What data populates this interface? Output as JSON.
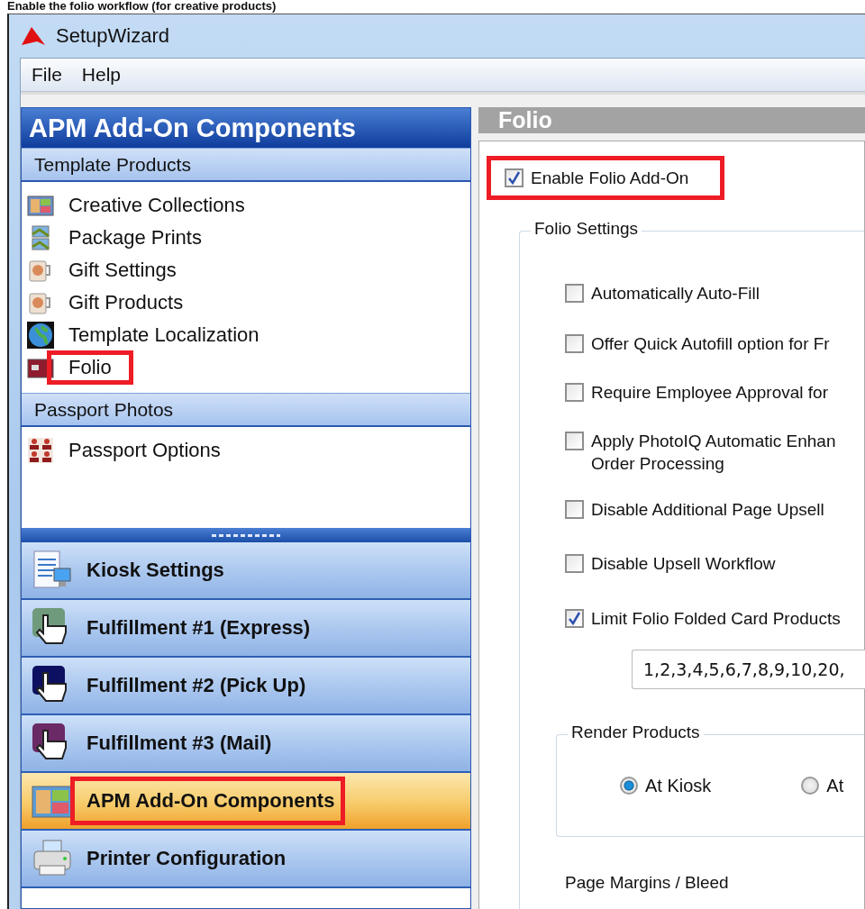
{
  "caption": "Enable the folio workflow (for creative products)",
  "window": {
    "title": "SetupWizard"
  },
  "menu": [
    "File",
    "Help"
  ],
  "sidebar": {
    "title": "APM Add-On Components",
    "sections": [
      {
        "title": "Template Products",
        "items": [
          {
            "label": "Creative Collections",
            "kind": "collage",
            "highlighted": false
          },
          {
            "label": "Package Prints",
            "kind": "prints",
            "highlighted": false
          },
          {
            "label": "Gift Settings",
            "kind": "mug",
            "highlighted": false
          },
          {
            "label": "Gift Products",
            "kind": "mug",
            "highlighted": false
          },
          {
            "label": "Template Localization",
            "kind": "globe",
            "highlighted": false
          },
          {
            "label": "Folio",
            "kind": "folio",
            "highlighted": true
          }
        ]
      },
      {
        "title": "Passport Photos",
        "items": [
          {
            "label": "Passport Options",
            "kind": "passport",
            "highlighted": false
          }
        ]
      }
    ],
    "nav": [
      {
        "label": "Kiosk Settings",
        "kind": "kiosk",
        "selected": false,
        "highlighted": false
      },
      {
        "label": "Fulfillment #1 (Express)",
        "kind": "hand",
        "color": "#6f9a7c",
        "selected": false,
        "highlighted": false
      },
      {
        "label": "Fulfillment #2 (Pick Up)",
        "kind": "hand",
        "color": "#0d1060",
        "selected": false,
        "highlighted": false
      },
      {
        "label": "Fulfillment #3 (Mail)",
        "kind": "hand",
        "color": "#6a2a66",
        "selected": false,
        "highlighted": false
      },
      {
        "label": "APM Add-On Components",
        "kind": "collage",
        "selected": true,
        "highlighted": true
      },
      {
        "label": "Printer Configuration",
        "kind": "printer",
        "selected": false,
        "highlighted": false
      }
    ]
  },
  "panel": {
    "title": "Folio",
    "enable": {
      "label": "Enable Folio Add-On",
      "checked": true,
      "highlighted": true
    },
    "folio_settings": {
      "title": "Folio Settings",
      "options": [
        {
          "label": "Automatically Auto-Fill",
          "checked": false
        },
        {
          "label": "Offer Quick Autofill option for Fr",
          "checked": false
        },
        {
          "label": "Require Employee Approval for",
          "checked": false
        },
        {
          "label": "Apply PhotoIQ Automatic Enhan\nOrder Processing",
          "checked": false
        },
        {
          "label": "Disable Additional Page Upsell",
          "checked": false
        },
        {
          "label": "Disable Upsell Workflow",
          "checked": false
        },
        {
          "label": "Limit Folio Folded Card Products",
          "checked": true
        }
      ],
      "limit_value": "1,2,3,4,5,6,7,8,9,10,20,",
      "render_products": {
        "title": "Render Products",
        "options": [
          {
            "label": "At Kiosk",
            "selected": true
          },
          {
            "label": "At",
            "selected": false
          }
        ]
      },
      "next_group": "Page Margins / Bleed"
    }
  }
}
